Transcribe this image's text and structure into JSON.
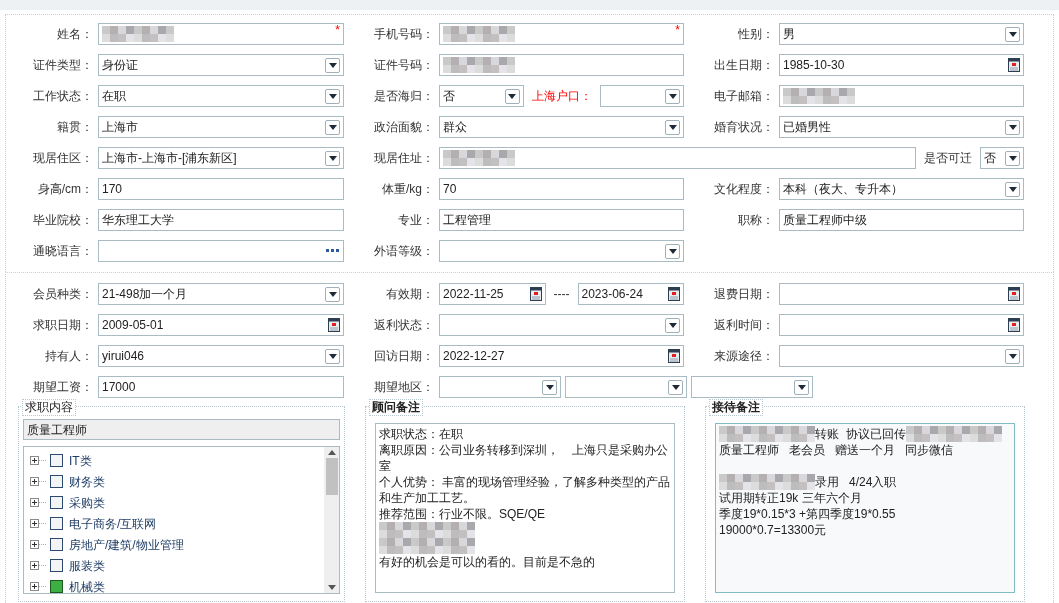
{
  "profile": {
    "rows": [
      {
        "cells": [
          {
            "label": "姓名：",
            "items": [
              {
                "kind": "text",
                "redacted": true,
                "required_mark": "*"
              }
            ]
          },
          {
            "label": "手机号码：",
            "items": [
              {
                "kind": "text",
                "redacted": true,
                "required_mark": "*"
              }
            ]
          },
          {
            "label": "性别：",
            "items": [
              {
                "kind": "select",
                "value": "男"
              }
            ]
          }
        ]
      },
      {
        "cells": [
          {
            "label": "证件类型：",
            "items": [
              {
                "kind": "select",
                "value": "身份证"
              }
            ]
          },
          {
            "label": "证件号码：",
            "items": [
              {
                "kind": "text",
                "redacted": true
              }
            ]
          },
          {
            "label": "出生日期：",
            "items": [
              {
                "kind": "date",
                "value": "1985-10-30"
              }
            ]
          }
        ]
      },
      {
        "cells": [
          {
            "label": "工作状态：",
            "items": [
              {
                "kind": "select",
                "value": "在职"
              }
            ]
          },
          {
            "label": "是否海归：",
            "items": [
              {
                "kind": "select",
                "value": "否"
              },
              {
                "kind": "label",
                "text": "上海户口：",
                "highlighted": true
              },
              {
                "kind": "select"
              }
            ]
          },
          {
            "label": "电子邮箱：",
            "items": [
              {
                "kind": "text",
                "redacted": true
              }
            ]
          }
        ]
      },
      {
        "cells": [
          {
            "label": "籍贯：",
            "items": [
              {
                "kind": "select",
                "value": "上海市"
              }
            ]
          },
          {
            "label": "政治面貌：",
            "items": [
              {
                "kind": "select",
                "value": "群众"
              }
            ]
          },
          {
            "label": "婚育状况：",
            "items": [
              {
                "kind": "select",
                "value": "已婚男性"
              }
            ]
          }
        ]
      },
      {
        "cells": [
          {
            "label": "现居住区：",
            "items": [
              {
                "kind": "select",
                "value": "上海市-上海市-[浦东新区]"
              }
            ]
          },
          {
            "label": "现居住址：",
            "wide": true,
            "items": [
              {
                "kind": "text",
                "redacted": true
              },
              {
                "kind": "label",
                "text": "是否可迁",
                "highlighted": false
              },
              {
                "kind": "select",
                "value": "否"
              }
            ]
          }
        ]
      },
      {
        "cells": [
          {
            "label": "身高/cm：",
            "items": [
              {
                "kind": "text",
                "value": "170"
              }
            ]
          },
          {
            "label": "体重/kg：",
            "items": [
              {
                "kind": "text",
                "value": "70"
              }
            ]
          },
          {
            "label": "文化程度：",
            "items": [
              {
                "kind": "select",
                "value": "本科（夜大、专升本）"
              }
            ]
          }
        ]
      },
      {
        "cells": [
          {
            "label": "毕业院校：",
            "items": [
              {
                "kind": "text",
                "value": "华东理工大学"
              }
            ]
          },
          {
            "label": "专业：",
            "items": [
              {
                "kind": "text",
                "value": "工程管理"
              }
            ]
          },
          {
            "label": "职称：",
            "items": [
              {
                "kind": "text",
                "value": "质量工程师中级"
              }
            ]
          }
        ]
      },
      {
        "cells": [
          {
            "label": "通晓语言：",
            "items": [
              {
                "kind": "lookup"
              }
            ]
          },
          {
            "label": "外语等级：",
            "items": [
              {
                "kind": "select"
              }
            ]
          }
        ]
      }
    ]
  },
  "membership": {
    "rows": [
      {
        "cells": [
          {
            "label": "会员种类：",
            "items": [
              {
                "kind": "select",
                "value": "21-498加一个月"
              }
            ]
          },
          {
            "label": "有效期：",
            "items": [
              {
                "kind": "date",
                "value": "2022-11-25"
              },
              {
                "kind": "label",
                "text": "----",
                "highlighted": false
              },
              {
                "kind": "date",
                "value": "2023-06-24"
              }
            ]
          },
          {
            "label": "退费日期：",
            "items": [
              {
                "kind": "date"
              }
            ]
          }
        ]
      },
      {
        "cells": [
          {
            "label": "求职日期：",
            "items": [
              {
                "kind": "date",
                "value": "2009-05-01"
              }
            ]
          },
          {
            "label": "返利状态：",
            "items": [
              {
                "kind": "select"
              }
            ]
          },
          {
            "label": "返利时间：",
            "items": [
              {
                "kind": "date"
              }
            ]
          }
        ]
      },
      {
        "cells": [
          {
            "label": "持有人：",
            "items": [
              {
                "kind": "select",
                "value": "yirui046"
              }
            ]
          },
          {
            "label": "回访日期：",
            "items": [
              {
                "kind": "date",
                "value": "2022-12-27"
              }
            ]
          },
          {
            "label": "来源途径：",
            "items": [
              {
                "kind": "select"
              }
            ]
          }
        ]
      },
      {
        "cells": [
          {
            "label": "期望工资：",
            "items": [
              {
                "kind": "text",
                "value": "17000"
              }
            ]
          },
          {
            "label": "期望地区：",
            "wide": true,
            "items": [
              {
                "kind": "select"
              },
              {
                "kind": "select"
              },
              {
                "kind": "select"
              }
            ]
          }
        ]
      }
    ]
  },
  "panels": [
    {
      "kind": "tree",
      "legend": "求职内容",
      "search": "质量工程师",
      "items": [
        {
          "label": "IT类",
          "checked": false,
          "expanded": false
        },
        {
          "label": "财务类",
          "checked": false,
          "expanded": false
        },
        {
          "label": "采购类",
          "checked": false,
          "expanded": false
        },
        {
          "label": "电子商务/互联网",
          "checked": false,
          "expanded": false
        },
        {
          "label": "房地产/建筑/物业管理",
          "checked": false,
          "expanded": false
        },
        {
          "label": "服装类",
          "checked": false,
          "expanded": false
        },
        {
          "label": "机械类",
          "checked": true,
          "expanded": false
        }
      ]
    },
    {
      "kind": "notes",
      "legend": "顾问备注",
      "focused": false,
      "lines": [
        {
          "parts": [
            {
              "kind": "text",
              "text": "求职状态：在职"
            }
          ]
        },
        {
          "parts": [
            {
              "kind": "text",
              "text": "离职原因：公司业务转移到深圳，    上海只是采购办公室"
            }
          ]
        },
        {
          "parts": [
            {
              "kind": "text",
              "text": "个人优势： 丰富的现场管理经验，了解多种类型的产品和生产加工工艺。"
            }
          ]
        },
        {
          "parts": [
            {
              "kind": "text",
              "text": "推荐范围：行业不限。SQE/QE"
            }
          ]
        },
        {
          "parts": [
            {
              "kind": "redacted"
            }
          ]
        },
        {
          "parts": [
            {
              "kind": "redacted"
            }
          ]
        },
        {
          "parts": [
            {
              "kind": "text",
              "text": "有好的机会是可以的看的。目前是不急的"
            }
          ]
        }
      ]
    },
    {
      "kind": "notes",
      "legend": "接待备注",
      "focused": true,
      "lines": [
        {
          "parts": [
            {
              "kind": "redacted"
            },
            {
              "kind": "text",
              "text": "转账  协议已回传"
            },
            {
              "kind": "redacted"
            }
          ]
        },
        {
          "parts": [
            {
              "kind": "text",
              "text": "质量工程师   老会员   赠送一个月   同步微信"
            }
          ]
        },
        {
          "kind": "blank"
        },
        {
          "parts": [
            {
              "kind": "redacted"
            },
            {
              "kind": "text",
              "text": "录用   4/24入职"
            }
          ]
        },
        {
          "parts": [
            {
              "kind": "text",
              "text": "试用期转正19k 三年六个月"
            }
          ]
        },
        {
          "parts": [
            {
              "kind": "text",
              "text": "季度19*0.15*3 +第四季度19*0.55"
            }
          ]
        },
        {
          "parts": [
            {
              "kind": "text",
              "text": "19000*0.7=13300元"
            }
          ]
        }
      ]
    }
  ]
}
